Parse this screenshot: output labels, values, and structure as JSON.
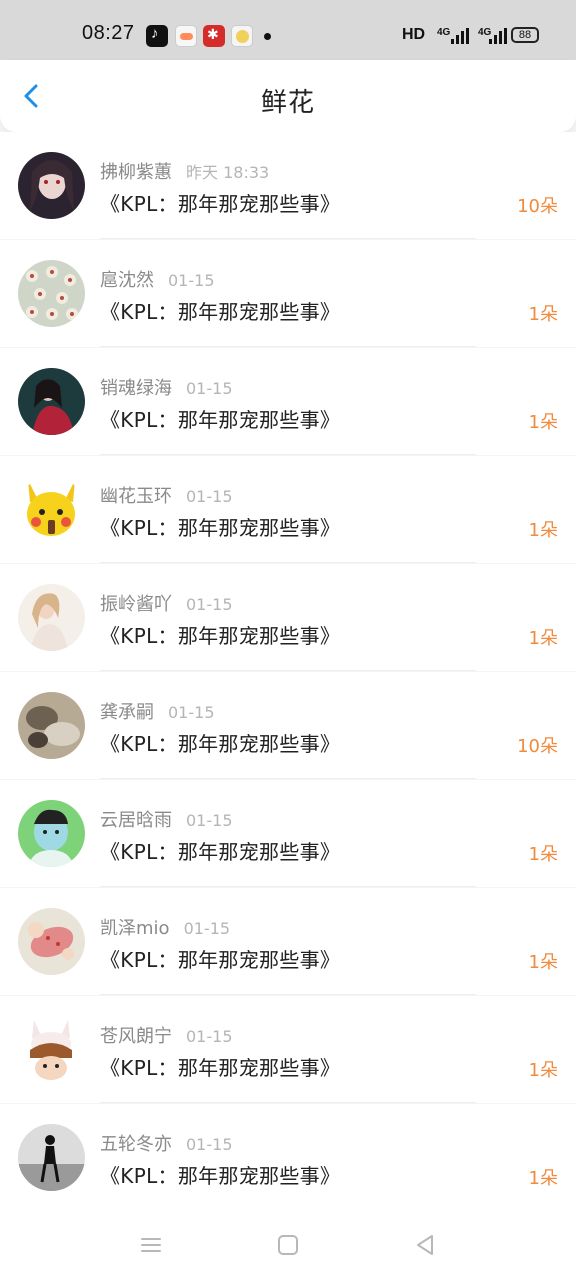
{
  "status": {
    "time": "08:27",
    "notifications": [
      "tiktok-icon",
      "game-icon",
      "red-app-icon",
      "face-app-icon"
    ],
    "hd": "HD",
    "signal1": "4G",
    "signal2": "4G",
    "battery": "88"
  },
  "header": {
    "title": "鲜花",
    "back_icon": "chevron-left-icon"
  },
  "colors": {
    "accent": "#1e8fe6",
    "count": "#f08a3c",
    "name": "#8a8a8a",
    "time": "#b5b5b5"
  },
  "rows": [
    {
      "name": "拂柳紫蕙",
      "time": "昨天 18:33",
      "work": "《KPL：那年那宠那些事》",
      "count": "10朵"
    },
    {
      "name": "扈沈然",
      "time": "01-15",
      "work": "《KPL：那年那宠那些事》",
      "count": "1朵"
    },
    {
      "name": "销魂绿海",
      "time": "01-15",
      "work": "《KPL：那年那宠那些事》",
      "count": "1朵"
    },
    {
      "name": "幽花玉环",
      "time": "01-15",
      "work": "《KPL：那年那宠那些事》",
      "count": "1朵"
    },
    {
      "name": "振岭酱吖",
      "time": "01-15",
      "work": "《KPL：那年那宠那些事》",
      "count": "1朵"
    },
    {
      "name": "龚承嗣",
      "time": "01-15",
      "work": "《KPL：那年那宠那些事》",
      "count": "10朵"
    },
    {
      "name": "云居晗雨",
      "time": "01-15",
      "work": "《KPL：那年那宠那些事》",
      "count": "1朵"
    },
    {
      "name": "凯泽mio",
      "time": "01-15",
      "work": "《KPL：那年那宠那些事》",
      "count": "1朵"
    },
    {
      "name": "苍风朗宁",
      "time": "01-15",
      "work": "《KPL：那年那宠那些事》",
      "count": "1朵"
    },
    {
      "name": "五轮冬亦",
      "time": "01-15",
      "work": "《KPL：那年那宠那些事》",
      "count": "1朵"
    }
  ],
  "nav": [
    "menu-icon",
    "home-icon",
    "back-icon"
  ]
}
